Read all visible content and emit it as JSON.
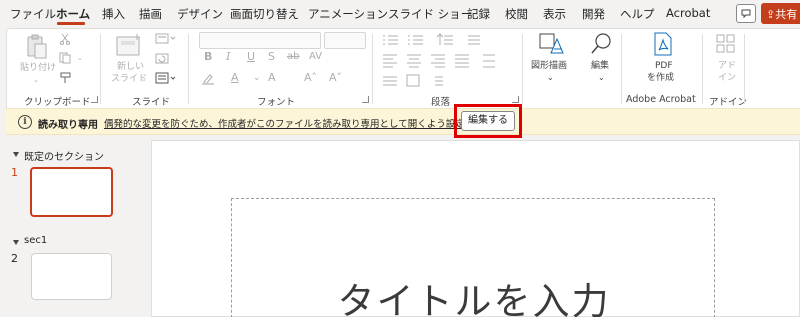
{
  "menu": {
    "items": [
      "ファイル",
      "ホーム",
      "挿入",
      "描画",
      "デザイン",
      "画面切り替え",
      "アニメーション",
      "スライド ショー",
      "記録",
      "校閲",
      "表示",
      "開発",
      "ヘルプ",
      "Acrobat"
    ],
    "share_label": "共有"
  },
  "ribbon": {
    "clipboard": {
      "paste_label": "貼り付け",
      "group_label": "クリップボード"
    },
    "slides": {
      "new_slide_line1": "新しい",
      "new_slide_line2": "スライド",
      "group_label": "スライド"
    },
    "font": {
      "bold": "B",
      "italic": "I",
      "underline": "U",
      "strike": "S",
      "spacing": "ab",
      "case": "AV",
      "font_color": "A",
      "grow": "A˄",
      "shrink": "A˅",
      "clear": "A",
      "group_label": "フォント"
    },
    "paragraph": {
      "group_label": "段落"
    },
    "drawing": {
      "shapes_label": "図形描画"
    },
    "editing": {
      "label": "編集"
    },
    "adobe": {
      "line1": "PDF",
      "line2": "を作成",
      "group_label": "Adobe Acrobat"
    },
    "addins": {
      "line1": "アド",
      "line2": "イン",
      "group_label": "アドイン"
    }
  },
  "infobar": {
    "title": "読み取り専用",
    "message": "偶発的な変更を防ぐため、作成者がこのファイルを読み取り専用として開くよう設定しました。",
    "edit_button": "編集する"
  },
  "panel": {
    "sections": [
      {
        "title": "既定のセクション",
        "slide_number": "1"
      },
      {
        "title": "sec1",
        "slide_number": "2"
      }
    ]
  },
  "slide": {
    "title_placeholder": "タイトルを入力"
  },
  "colors": {
    "accent": "#c43e1c",
    "highlight": "#e00000",
    "infobar": "#fcf5d8"
  }
}
